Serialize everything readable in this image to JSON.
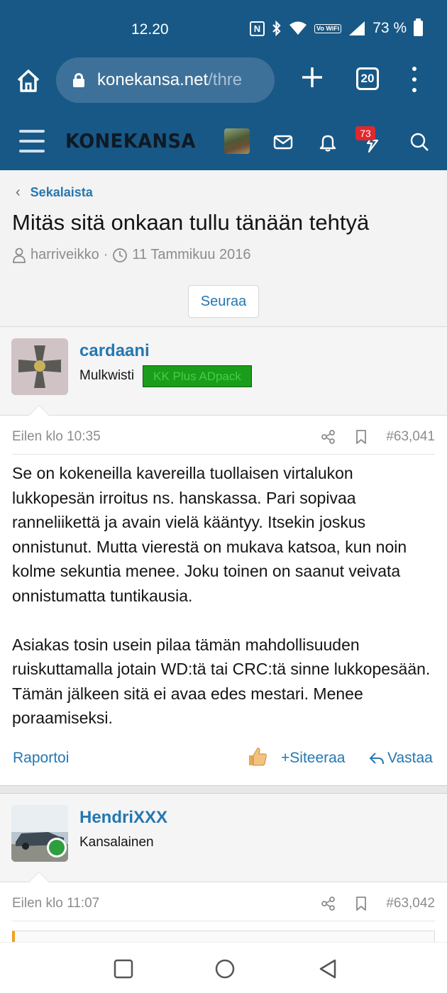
{
  "status_bar": {
    "time": "12.20",
    "volte_label": "Vo WiFi",
    "battery": "73 %",
    "icons": [
      "nfc-icon",
      "bluetooth-icon",
      "wifi-icon",
      "volte-icon",
      "signal-icon",
      "battery-icon"
    ]
  },
  "browser": {
    "url_main": "konekansa.net",
    "url_rest": "/thre",
    "tab_count": "20"
  },
  "site_header": {
    "logo": "KONEKANSA",
    "alerts_count": "73"
  },
  "breadcrumb": "Sekalaista",
  "thread": {
    "title": "Mitäs sitä onkaan tullu tänään tehtyä",
    "author": "harriveikko",
    "date": "11 Tammikuu 2016",
    "follow_label": "Seuraa"
  },
  "posts": [
    {
      "username": "cardaani",
      "user_title": "Mulkwisti",
      "banner": "KK Plus ADpack",
      "date": "Eilen klo 10:35",
      "number": "#63,041",
      "body": [
        "Se on kokeneilla kavereilla tuollaisen virtalukon lukkopesän irroitus ns. hanskassa. Pari sopivaa ranneliikettä ja avain vielä kääntyy. Itsekin joskus onnistunut. Mutta vierestä on mukava katsoa, kun noin kolme sekuntia menee. Joku toinen on saanut veivata onnistumatta tuntikausia.",
        "Asiakas tosin usein pilaa tämän mahdollisuuden ruiskuttamalla jotain WD:tä tai CRC:tä sinne lukkopesään. Tämän jälkeen sitä ei avaa edes mestari. Menee poraamiseksi."
      ],
      "actions": {
        "report": "Raportoi",
        "quote": "Siteeraa",
        "reply": "Vastaa"
      }
    },
    {
      "username": "HendriXXX",
      "user_title": "Kansalainen",
      "date": "Eilen klo 11:07",
      "number": "#63,042"
    }
  ],
  "colors": {
    "header_bg": "#185886",
    "link": "#2577b1",
    "banner_bg": "#1a9d1a",
    "alert_badge": "#e0282e"
  }
}
